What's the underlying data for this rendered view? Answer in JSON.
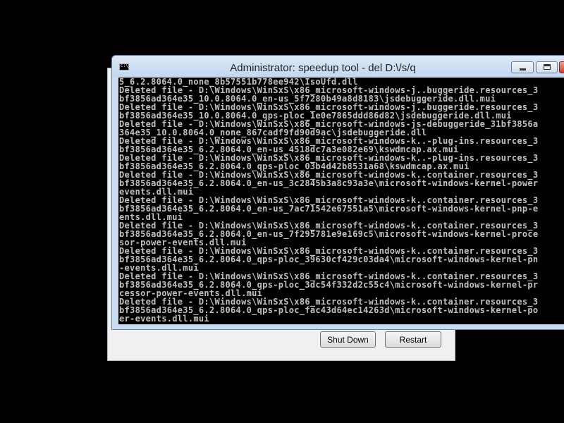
{
  "console": {
    "title": "Administrator:  speedup tool - del  D:\\/s/q",
    "lines": [
      "5_6.2.8064.0_none_8b57551b778ee942\\IsoUfd.dll",
      "Deleted file - D:\\Windows\\WinSxS\\x86_microsoft-windows-j..buggeride.resources_3",
      "bf3856ad364e35_10.0.8064.0_en-us_5f7280b49a8d8183\\jsdebuggeride.dll.mui",
      "Deleted file - D:\\Windows\\WinSxS\\x86_microsoft-windows-j..buggeride.resources_3",
      "bf3856ad364e35_10.0.8064.0_qps-ploc_1e0e7865ddd86d82\\jsdebuggeride.dll.mui",
      "Deleted file - D:\\Windows\\WinSxS\\x86_microsoft-windows-js-debuggeride_31bf3856a",
      "364e35_10.0.8064.0_none_867cadf9fd90d9ac\\jsdebuggeride.dll",
      "Deleted file - D:\\Windows\\WinSxS\\x86_microsoft-windows-k..-plug-ins.resources_3",
      "bf3856ad364e35_6.2.8064.0_en-us_4518dc7a3e082e69\\kswdmcap.ax.mui",
      "Deleted file - D:\\Windows\\WinSxS\\x86_microsoft-windows-k..-plug-ins.resources_3",
      "bf3856ad364e35_6.2.8064.0_qps-ploc_03b4d42b8531a68\\kswdmcap.ax.mui",
      "Deleted file - D:\\Windows\\WinSxS\\x86_microsoft-windows-k..container.resources_3",
      "bf3856ad364e35_6.2.8064.0_en-us_3c2845b3a8c93a3e\\microsoft-windows-kernel-power",
      "events.dll.mui",
      "Deleted file - D:\\Windows\\WinSxS\\x86_microsoft-windows-k..container.resources_3",
      "bf3856ad364e35_6.2.8064.0_en-us_7ac71542e67551a5\\microsoft-windows-kernel-pnp-e",
      "ents.dll.mui",
      "Deleted file - D:\\Windows\\WinSxS\\x86_microsoft-windows-k..container.resources_3",
      "bf3856ad364e35_6.2.8064.0_en-us_7f295781e9e169c5\\microsoft-windows-kernel-proce",
      "sor-power-events.dll.mui",
      "Deleted file - D:\\Windows\\WinSxS\\x86_microsoft-windows-k..container.resources_3",
      "bf3856ad364e35_6.2.8064.0_qps-ploc_39630cf429c03da4\\microsoft-windows-kernel-pn",
      "-events.dll.mui",
      "Deleted file - D:\\Windows\\WinSxS\\x86_microsoft-windows-k..container.resources_3",
      "bf3856ad364e35_6.2.8064.0_qps-ploc_3dc54f332d2c55c4\\microsoft-windows-kernel-pr",
      "cessor-power-events.dll.mui",
      "Deleted file - D:\\Windows\\WinSxS\\x86_microsoft-windows-k..container.resources_3",
      "bf3856ad364e35_6.2.8064.0_qps-ploc_fac43d64ec14263d\\microsoft-windows-kernel-po",
      "er-events.dll.mui"
    ]
  },
  "dialog": {
    "shutdown_label": "Shut Down",
    "restart_label": "Restart"
  },
  "icons": {
    "app": "console-icon",
    "minimize": "minimize-icon",
    "maximize": "maximize-icon",
    "close": "close-icon"
  }
}
